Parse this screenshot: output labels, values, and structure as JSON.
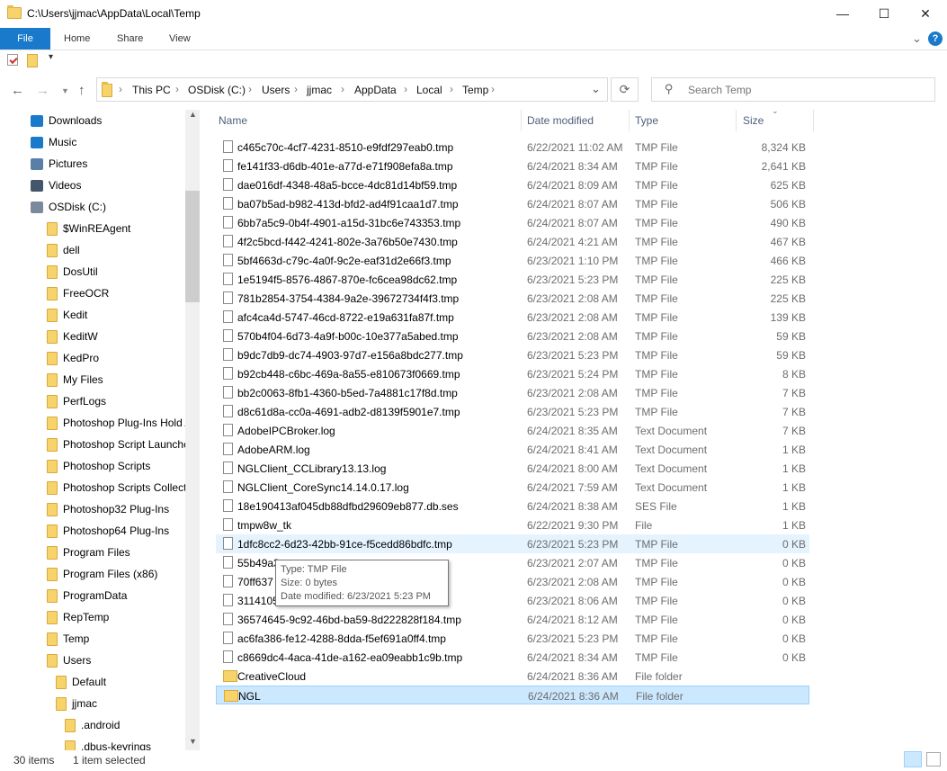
{
  "window": {
    "title": "C:\\Users\\jjmac\\AppData\\Local\\Temp",
    "minimize_glyph": "—",
    "maximize_glyph": "☐",
    "close_glyph": "✕"
  },
  "ribbon": {
    "tabs": [
      "File",
      "Home",
      "Share",
      "View"
    ],
    "expand_glyph": "⌄",
    "help_glyph": "?"
  },
  "address": {
    "crumbs": [
      "This PC",
      "OSDisk (C:)",
      "Users",
      "jjmac",
      "AppData",
      "Local",
      "Temp"
    ],
    "separator": "›"
  },
  "search": {
    "placeholder": "Search Temp"
  },
  "nav_pane": {
    "items": [
      {
        "label": "Downloads",
        "icon": "download-icon",
        "indent": 0
      },
      {
        "label": "Music",
        "icon": "music-icon",
        "indent": 0
      },
      {
        "label": "Pictures",
        "icon": "pictures-icon",
        "indent": 0
      },
      {
        "label": "Videos",
        "icon": "videos-icon",
        "indent": 0
      },
      {
        "label": "OSDisk (C:)",
        "icon": "drive-icon",
        "indent": 0
      },
      {
        "label": "$WinREAgent",
        "icon": "folder-icon",
        "indent": 1
      },
      {
        "label": "dell",
        "icon": "folder-icon",
        "indent": 1
      },
      {
        "label": "DosUtil",
        "icon": "folder-icon",
        "indent": 1
      },
      {
        "label": "FreeOCR",
        "icon": "folder-icon",
        "indent": 1
      },
      {
        "label": "Kedit",
        "icon": "folder-icon",
        "indent": 1
      },
      {
        "label": "KeditW",
        "icon": "folder-icon",
        "indent": 1
      },
      {
        "label": "KedPro",
        "icon": "folder-icon",
        "indent": 1
      },
      {
        "label": "My Files",
        "icon": "folder-icon",
        "indent": 1
      },
      {
        "label": "PerfLogs",
        "icon": "folder-icon",
        "indent": 1
      },
      {
        "label": "Photoshop  Plug-Ins Hold A",
        "icon": "folder-icon",
        "indent": 1
      },
      {
        "label": "Photoshop Script Launcher",
        "icon": "folder-icon",
        "indent": 1
      },
      {
        "label": "Photoshop Scripts",
        "icon": "folder-icon",
        "indent": 1
      },
      {
        "label": "Photoshop Scripts Collectio",
        "icon": "folder-icon",
        "indent": 1
      },
      {
        "label": "Photoshop32 Plug-Ins",
        "icon": "folder-icon",
        "indent": 1
      },
      {
        "label": "Photoshop64 Plug-Ins",
        "icon": "folder-icon",
        "indent": 1
      },
      {
        "label": "Program Files",
        "icon": "folder-icon",
        "indent": 1
      },
      {
        "label": "Program Files (x86)",
        "icon": "folder-icon",
        "indent": 1
      },
      {
        "label": "ProgramData",
        "icon": "folder-icon",
        "indent": 1
      },
      {
        "label": "RepTemp",
        "icon": "folder-icon",
        "indent": 1
      },
      {
        "label": "Temp",
        "icon": "folder-icon",
        "indent": 1
      },
      {
        "label": "Users",
        "icon": "folder-icon",
        "indent": 1
      },
      {
        "label": "Default",
        "icon": "folder-icon",
        "indent": 2
      },
      {
        "label": "jjmac",
        "icon": "folder-icon",
        "indent": 2
      },
      {
        "label": ".android",
        "icon": "folder-icon",
        "indent": 3
      },
      {
        "label": ".dbus-keyrings",
        "icon": "folder-icon",
        "indent": 3
      }
    ]
  },
  "columns": {
    "name": "Name",
    "date": "Date modified",
    "type": "Type",
    "size": "Size"
  },
  "files": [
    {
      "name": "c465c70c-4cf7-4231-8510-e9fdf297eab0.tmp",
      "date": "6/22/2021 11:02 AM",
      "type": "TMP File",
      "size": "8,324 KB",
      "kind": "file"
    },
    {
      "name": "fe141f33-d6db-401e-a77d-e71f908efa8a.tmp",
      "date": "6/24/2021 8:34 AM",
      "type": "TMP File",
      "size": "2,641 KB",
      "kind": "file"
    },
    {
      "name": "dae016df-4348-48a5-bcce-4dc81d14bf59.tmp",
      "date": "6/24/2021 8:09 AM",
      "type": "TMP File",
      "size": "625 KB",
      "kind": "file"
    },
    {
      "name": "ba07b5ad-b982-413d-bfd2-ad4f91caa1d7.tmp",
      "date": "6/24/2021 8:07 AM",
      "type": "TMP File",
      "size": "506 KB",
      "kind": "file"
    },
    {
      "name": "6bb7a5c9-0b4f-4901-a15d-31bc6e743353.tmp",
      "date": "6/24/2021 8:07 AM",
      "type": "TMP File",
      "size": "490 KB",
      "kind": "file"
    },
    {
      "name": "4f2c5bcd-f442-4241-802e-3a76b50e7430.tmp",
      "date": "6/24/2021 4:21 AM",
      "type": "TMP File",
      "size": "467 KB",
      "kind": "file"
    },
    {
      "name": "5bf4663d-c79c-4a0f-9c2e-eaf31d2e66f3.tmp",
      "date": "6/23/2021 1:10 PM",
      "type": "TMP File",
      "size": "466 KB",
      "kind": "file"
    },
    {
      "name": "1e5194f5-8576-4867-870e-fc6cea98dc62.tmp",
      "date": "6/23/2021 5:23 PM",
      "type": "TMP File",
      "size": "225 KB",
      "kind": "file"
    },
    {
      "name": "781b2854-3754-4384-9a2e-39672734f4f3.tmp",
      "date": "6/23/2021 2:08 AM",
      "type": "TMP File",
      "size": "225 KB",
      "kind": "file"
    },
    {
      "name": "afc4ca4d-5747-46cd-8722-e19a631fa87f.tmp",
      "date": "6/23/2021 2:08 AM",
      "type": "TMP File",
      "size": "139 KB",
      "kind": "file"
    },
    {
      "name": "570b4f04-6d73-4a9f-b00c-10e377a5abed.tmp",
      "date": "6/23/2021 2:08 AM",
      "type": "TMP File",
      "size": "59 KB",
      "kind": "file"
    },
    {
      "name": "b9dc7db9-dc74-4903-97d7-e156a8bdc277.tmp",
      "date": "6/23/2021 5:23 PM",
      "type": "TMP File",
      "size": "59 KB",
      "kind": "file"
    },
    {
      "name": "b92cb448-c6bc-469a-8a55-e810673f0669.tmp",
      "date": "6/23/2021 5:24 PM",
      "type": "TMP File",
      "size": "8 KB",
      "kind": "file"
    },
    {
      "name": "bb2c0063-8fb1-4360-b5ed-7a4881c17f8d.tmp",
      "date": "6/23/2021 2:08 AM",
      "type": "TMP File",
      "size": "7 KB",
      "kind": "file"
    },
    {
      "name": "d8c61d8a-cc0a-4691-adb2-d8139f5901e7.tmp",
      "date": "6/23/2021 5:23 PM",
      "type": "TMP File",
      "size": "7 KB",
      "kind": "file"
    },
    {
      "name": "AdobeIPCBroker.log",
      "date": "6/24/2021 8:35 AM",
      "type": "Text Document",
      "size": "7 KB",
      "kind": "file"
    },
    {
      "name": "AdobeARM.log",
      "date": "6/24/2021 8:41 AM",
      "type": "Text Document",
      "size": "1 KB",
      "kind": "file"
    },
    {
      "name": "NGLClient_CCLibrary13.13.log",
      "date": "6/24/2021 8:00 AM",
      "type": "Text Document",
      "size": "1 KB",
      "kind": "file"
    },
    {
      "name": "NGLClient_CoreSync14.14.0.17.log",
      "date": "6/24/2021 7:59 AM",
      "type": "Text Document",
      "size": "1 KB",
      "kind": "file"
    },
    {
      "name": "18e190413af045db88dfbd29609eb877.db.ses",
      "date": "6/24/2021 8:38 AM",
      "type": "SES File",
      "size": "1 KB",
      "kind": "file"
    },
    {
      "name": "tmpw8w_tk",
      "date": "6/22/2021 9:30 PM",
      "type": "File",
      "size": "1 KB",
      "kind": "file"
    },
    {
      "name": "1dfc8cc2-6d23-42bb-91ce-f5cedd86bdfc.tmp",
      "date": "6/23/2021 5:23 PM",
      "type": "TMP File",
      "size": "0 KB",
      "kind": "file",
      "state": "hover"
    },
    {
      "name": "55b49a3",
      "date": "6/23/2021 2:07 AM",
      "type": "TMP File",
      "size": "0 KB",
      "kind": "file"
    },
    {
      "name": "70ff637",
      "date": "6/23/2021 2:08 AM",
      "type": "TMP File",
      "size": "0 KB",
      "kind": "file"
    },
    {
      "name": "3114105",
      "date": "6/23/2021 8:06 AM",
      "type": "TMP File",
      "size": "0 KB",
      "kind": "file"
    },
    {
      "name": "36574645-9c92-46bd-ba59-8d222828f184.tmp",
      "date": "6/24/2021 8:12 AM",
      "type": "TMP File",
      "size": "0 KB",
      "kind": "file"
    },
    {
      "name": "ac6fa386-fe12-4288-8dda-f5ef691a0ff4.tmp",
      "date": "6/23/2021 5:23 PM",
      "type": "TMP File",
      "size": "0 KB",
      "kind": "file"
    },
    {
      "name": "c8669dc4-4aca-41de-a162-ea09eabb1c9b.tmp",
      "date": "6/24/2021 8:34 AM",
      "type": "TMP File",
      "size": "0 KB",
      "kind": "file"
    },
    {
      "name": "CreativeCloud",
      "date": "6/24/2021 8:36 AM",
      "type": "File folder",
      "size": "",
      "kind": "folder"
    },
    {
      "name": "NGL",
      "date": "6/24/2021 8:36 AM",
      "type": "File folder",
      "size": "",
      "kind": "folder",
      "state": "selected"
    }
  ],
  "tooltip": {
    "type_line": "Type: TMP File",
    "size_line": "Size: 0 bytes",
    "date_line": "Date modified: 6/23/2021 5:23 PM"
  },
  "status": {
    "count": "30 items",
    "selected": "1 item selected"
  },
  "colors": {
    "accent": "#1979ca",
    "selection": "#cce8ff",
    "hover": "#e5f3ff",
    "folder": "#f7d36b"
  }
}
